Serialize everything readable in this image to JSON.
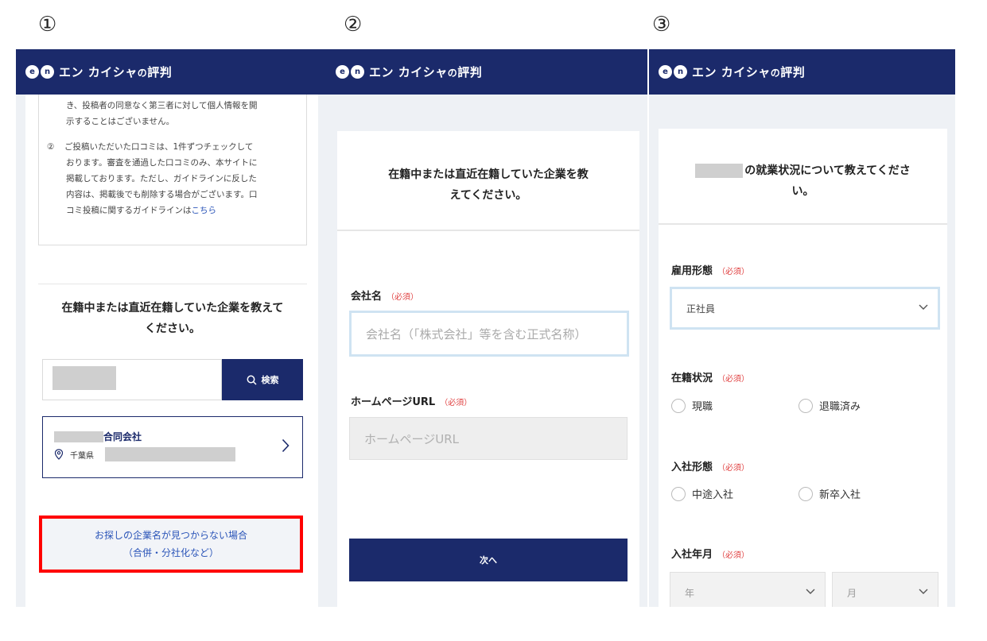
{
  "steps": [
    "①",
    "②",
    "③"
  ],
  "brand": {
    "name": "エン カイシャ",
    "suffix": "の",
    "name2": "評判",
    "logo_e": "e",
    "logo_n": "n"
  },
  "panel1": {
    "notice_lines": [
      "き、投稿者の同意なく第三者に対して個人情報を開",
      "示することはございません。"
    ],
    "notice_item2_num": "②",
    "notice_item2_lines": [
      "ご投稿いただいた口コミは、1件ずつチェックして",
      "おります。審査を通過した口コミのみ、本サイトに",
      "掲載しております。ただし、ガイドラインに反した",
      "内容は、掲載後でも削除する場合がございます。口"
    ],
    "notice_last_line": "コミ投稿に関するガイドラインは",
    "notice_link": "こちら",
    "question_line1": "在籍中または直近在籍していた企業を教えて",
    "question_line2": "ください。",
    "search_button": "検索",
    "result_company_suffix": "合同会社",
    "result_prefecture": "千葉県",
    "not_found_line1": "お探しの企業名が見つからない場合",
    "not_found_line2": "（合併・分社化など）"
  },
  "panel2": {
    "title_line1": "在籍中または直近在籍していた企業を教",
    "title_line2": "えてください。",
    "company_label": "会社名",
    "required": "（必須）",
    "company_placeholder": "会社名（「株式会社」等を含む正式名称）",
    "url_label": "ホームページURL",
    "url_placeholder": "ホームページURL",
    "next_button": "次へ"
  },
  "panel3": {
    "title_line1": "の就業状況について教えてくださ",
    "title_line2": "い。",
    "employment_label": "雇用形態",
    "employment_value": "正社員",
    "status_label": "在籍状況",
    "status_options": [
      "現職",
      "退職済み"
    ],
    "entry_label": "入社形態",
    "entry_options": [
      "中途入社",
      "新卒入社"
    ],
    "date_label": "入社年月",
    "year_placeholder": "年",
    "month_placeholder": "月",
    "required": "（必須）"
  }
}
